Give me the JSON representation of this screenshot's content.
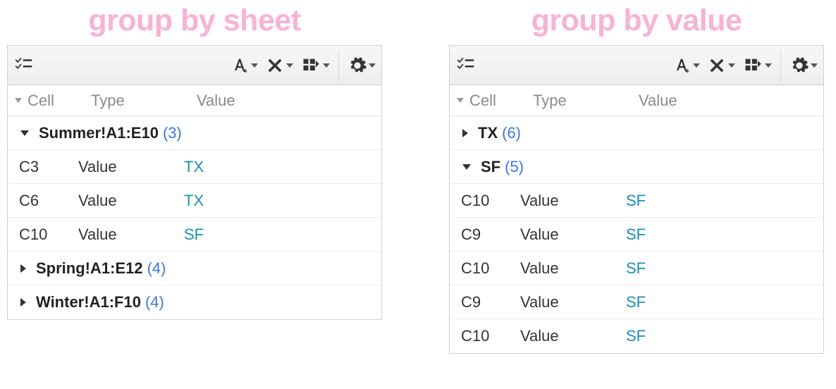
{
  "left": {
    "title": "group by sheet",
    "headers": {
      "cell": "Cell",
      "type": "Type",
      "value": "Value"
    },
    "groups": [
      {
        "name": "Summer!A1:E10",
        "count": "(3)",
        "expanded": true,
        "rows": [
          {
            "cell": "C3",
            "type": "Value",
            "value": "TX"
          },
          {
            "cell": "C6",
            "type": "Value",
            "value": "TX"
          },
          {
            "cell": "C10",
            "type": "Value",
            "value": "SF"
          }
        ]
      },
      {
        "name": "Spring!A1:E12",
        "count": "(4)",
        "expanded": false,
        "rows": []
      },
      {
        "name": "Winter!A1:F10",
        "count": "(4)",
        "expanded": false,
        "rows": []
      }
    ]
  },
  "right": {
    "title": "group by value",
    "headers": {
      "cell": "Cell",
      "type": "Type",
      "value": "Value"
    },
    "groups": [
      {
        "name": "TX",
        "count": "(6)",
        "expanded": false,
        "rows": []
      },
      {
        "name": "SF",
        "count": "(5)",
        "expanded": true,
        "rows": [
          {
            "cell": "C10",
            "type": "Value",
            "value": "SF"
          },
          {
            "cell": "C9",
            "type": "Value",
            "value": "SF"
          },
          {
            "cell": "C10",
            "type": "Value",
            "value": "SF"
          },
          {
            "cell": "C9",
            "type": "Value",
            "value": "SF"
          },
          {
            "cell": "C10",
            "type": "Value",
            "value": "SF"
          }
        ]
      }
    ]
  }
}
